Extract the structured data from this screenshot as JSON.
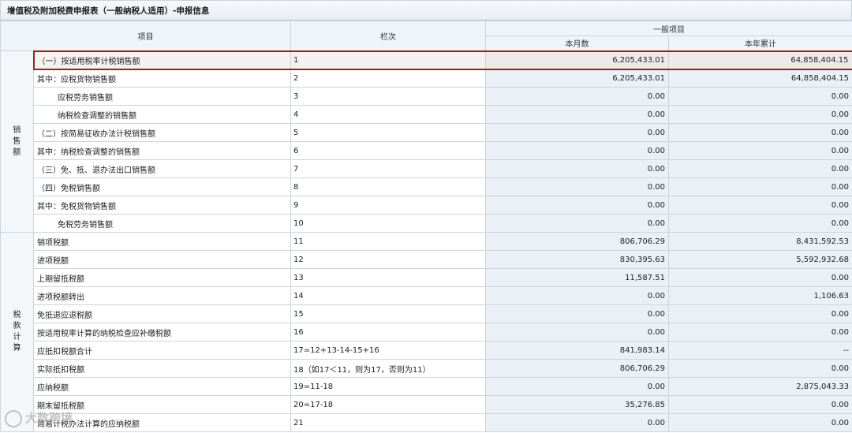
{
  "window": {
    "title": "增值税及附加税费申报表（一般纳税人适用）-申报信息"
  },
  "table": {
    "headers": {
      "item": "项目",
      "column": "栏次",
      "group": "一般项目",
      "month": "本月数",
      "year": "本年累计"
    },
    "sections": {
      "sales": "销售额",
      "tax": "税款计算"
    },
    "rows": [
      {
        "label": "（一）按适用税率计税销售额",
        "col": "1",
        "month": "6,205,433.01",
        "year": "64,858,404.15"
      },
      {
        "label": "其中：应税货物销售额",
        "col": "2",
        "month": "6,205,433.01",
        "year": "64,858,404.15"
      },
      {
        "label": "应税劳务销售额",
        "col": "3",
        "month": "0.00",
        "year": "0.00"
      },
      {
        "label": "纳税检查调整的销售额",
        "col": "4",
        "month": "0.00",
        "year": "0.00"
      },
      {
        "label": "（二）按简易征收办法计税销售额",
        "col": "5",
        "month": "0.00",
        "year": "0.00"
      },
      {
        "label": "其中：纳税检查调整的销售额",
        "col": "6",
        "month": "0.00",
        "year": "0.00"
      },
      {
        "label": "（三）免、抵、退办法出口销售额",
        "col": "7",
        "month": "0.00",
        "year": "0.00"
      },
      {
        "label": "（四）免税销售额",
        "col": "8",
        "month": "0.00",
        "year": "0.00"
      },
      {
        "label": "其中：免税货物销售额",
        "col": "9",
        "month": "0.00",
        "year": "0.00"
      },
      {
        "label": "免税劳务销售额",
        "col": "10",
        "month": "0.00",
        "year": "0.00"
      },
      {
        "label": "销项税额",
        "col": "11",
        "month": "806,706.29",
        "year": "8,431,592.53"
      },
      {
        "label": "进项税额",
        "col": "12",
        "month": "830,395.63",
        "year": "5,592,932.68"
      },
      {
        "label": "上期留抵税额",
        "col": "13",
        "month": "11,587.51",
        "year": "0.00"
      },
      {
        "label": "进项税额转出",
        "col": "14",
        "month": "0.00",
        "year": "1,106.63"
      },
      {
        "label": "免抵退应退税额",
        "col": "15",
        "month": "0.00",
        "year": "0.00"
      },
      {
        "label": "按适用税率计算的纳税检查应补缴税额",
        "col": "16",
        "month": "0.00",
        "year": "0.00"
      },
      {
        "label": "应抵扣税额合计",
        "col": "17=12+13-14-15+16",
        "month": "841,983.14",
        "year": "--"
      },
      {
        "label": "实际抵扣税额",
        "col": "18（如17＜11，则为17，否则为11）",
        "month": "806,706.29",
        "year": "0.00"
      },
      {
        "label": "应纳税额",
        "col": "19=11-18",
        "month": "0.00",
        "year": "2,875,043.33"
      },
      {
        "label": "期末留抵税额",
        "col": "20=17-18",
        "month": "35,276.85",
        "year": "0.00"
      },
      {
        "label": "简易计税办法计算的应纳税额",
        "col": "21",
        "month": "0.00",
        "year": "0.00"
      }
    ]
  },
  "watermark": {
    "text": "大数跨境"
  }
}
